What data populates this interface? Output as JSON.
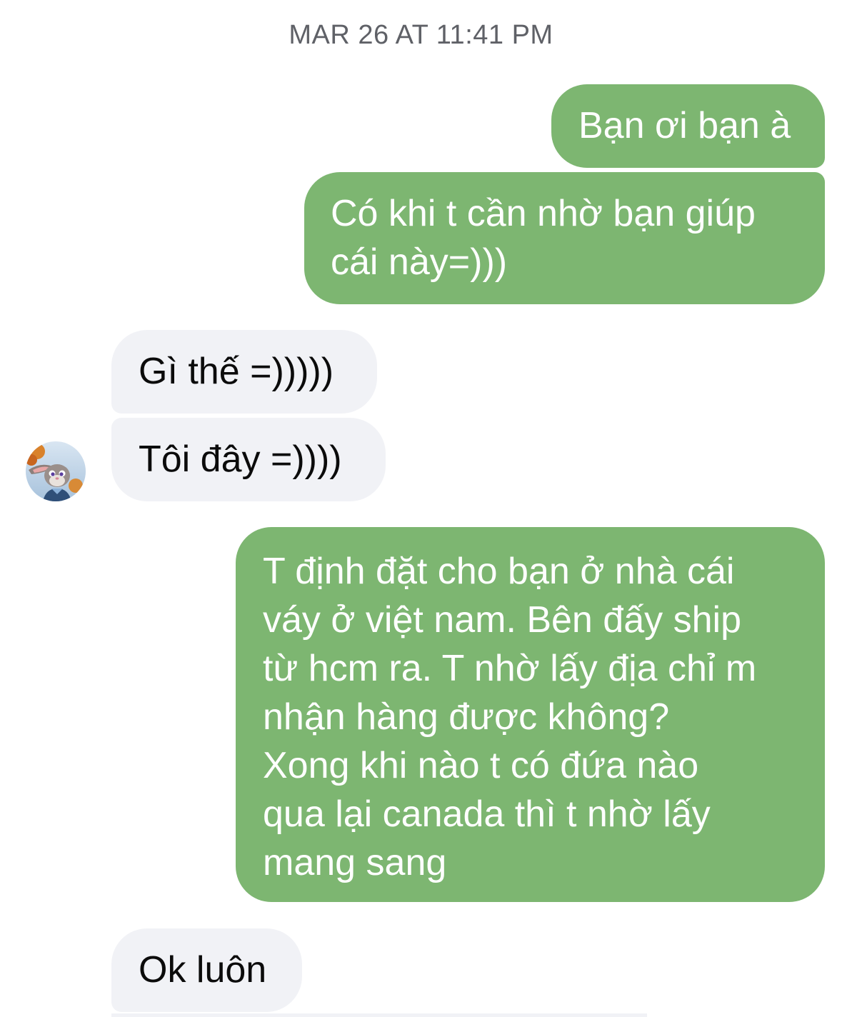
{
  "thread": {
    "timestamp": "MAR 26 AT 11:41 PM"
  },
  "messages": [
    {
      "sender": "me",
      "text": "Bạn ơi bạn à"
    },
    {
      "sender": "me",
      "text": "Có khi t cần nhờ bạn giúp\ncái này=)))"
    },
    {
      "sender": "contact",
      "text": "Gì thế =)))))"
    },
    {
      "sender": "contact",
      "text": "Tôi đây =))))"
    },
    {
      "sender": "me",
      "text": "T định đặt cho bạn ở nhà cái\nváy ở việt nam. Bên đấy ship\ntừ hcm ra. T nhờ lấy địa chỉ m\nnhận hàng được không?\nXong khi nào t có đứa nào\nqua lại canada thì t nhờ lấy\nmang sang"
    },
    {
      "sender": "contact",
      "text": "Ok luôn"
    }
  ],
  "contact": {
    "avatar_icon": "bunny-avatar-icon"
  },
  "colors": {
    "outgoing_bubble": "#7db671",
    "incoming_bubble": "#f1f2f6",
    "outgoing_text": "#ffffff",
    "incoming_text": "#0b0b0b",
    "timestamp_text": "#5f6167"
  }
}
